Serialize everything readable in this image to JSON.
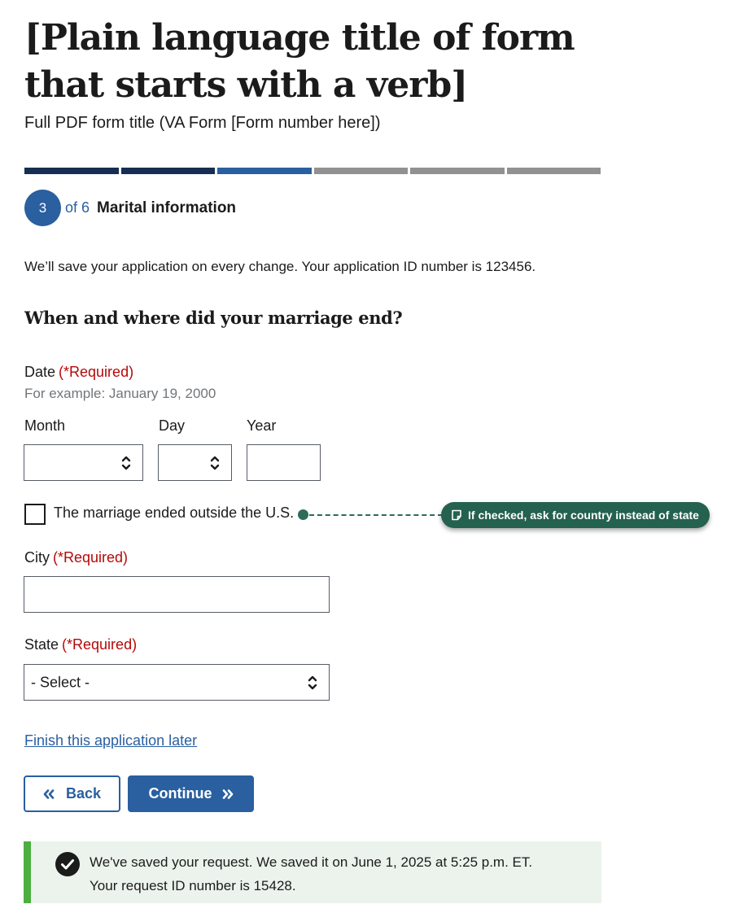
{
  "header": {
    "title": "[Plain language title of form that starts with a verb]",
    "subtitle": "Full PDF form title (VA Form [Form number here])"
  },
  "progress": {
    "total_steps": 6,
    "completed_steps": 2,
    "current_step": 3,
    "current_step_label": "3",
    "of_word": "of",
    "total_label": "6",
    "step_name": "Marital information",
    "colors": {
      "done": "#162e51",
      "current": "#2a5fa0",
      "todo": "#919191"
    }
  },
  "save_note": "We’ll save your application on every change. Your application ID number is 123456.",
  "question": "When and where did your marriage end?",
  "date": {
    "label": "Date",
    "required": "(*Required)",
    "hint": "For example: January 19, 2000",
    "month_label": "Month",
    "day_label": "Day",
    "year_label": "Year",
    "month_value": "",
    "day_value": "",
    "year_value": ""
  },
  "outside_us": {
    "label": "The marriage ended outside the U.S.",
    "checked": false,
    "annotation": "If checked, ask for country instead of state",
    "annotation_icon": "note-icon"
  },
  "city": {
    "label": "City",
    "required": "(*Required)",
    "value": ""
  },
  "state": {
    "label": "State",
    "required": "(*Required)",
    "selected": "- Select -"
  },
  "finish_link": "Finish this application later",
  "buttons": {
    "back": "Back",
    "continue": "Continue"
  },
  "alert": {
    "line1": "We've saved your request. We saved it on June 1, 2025 at 5:25 p.m. ET.",
    "line2": "Your request ID number is 15428.",
    "icon": "check-circle-icon"
  }
}
